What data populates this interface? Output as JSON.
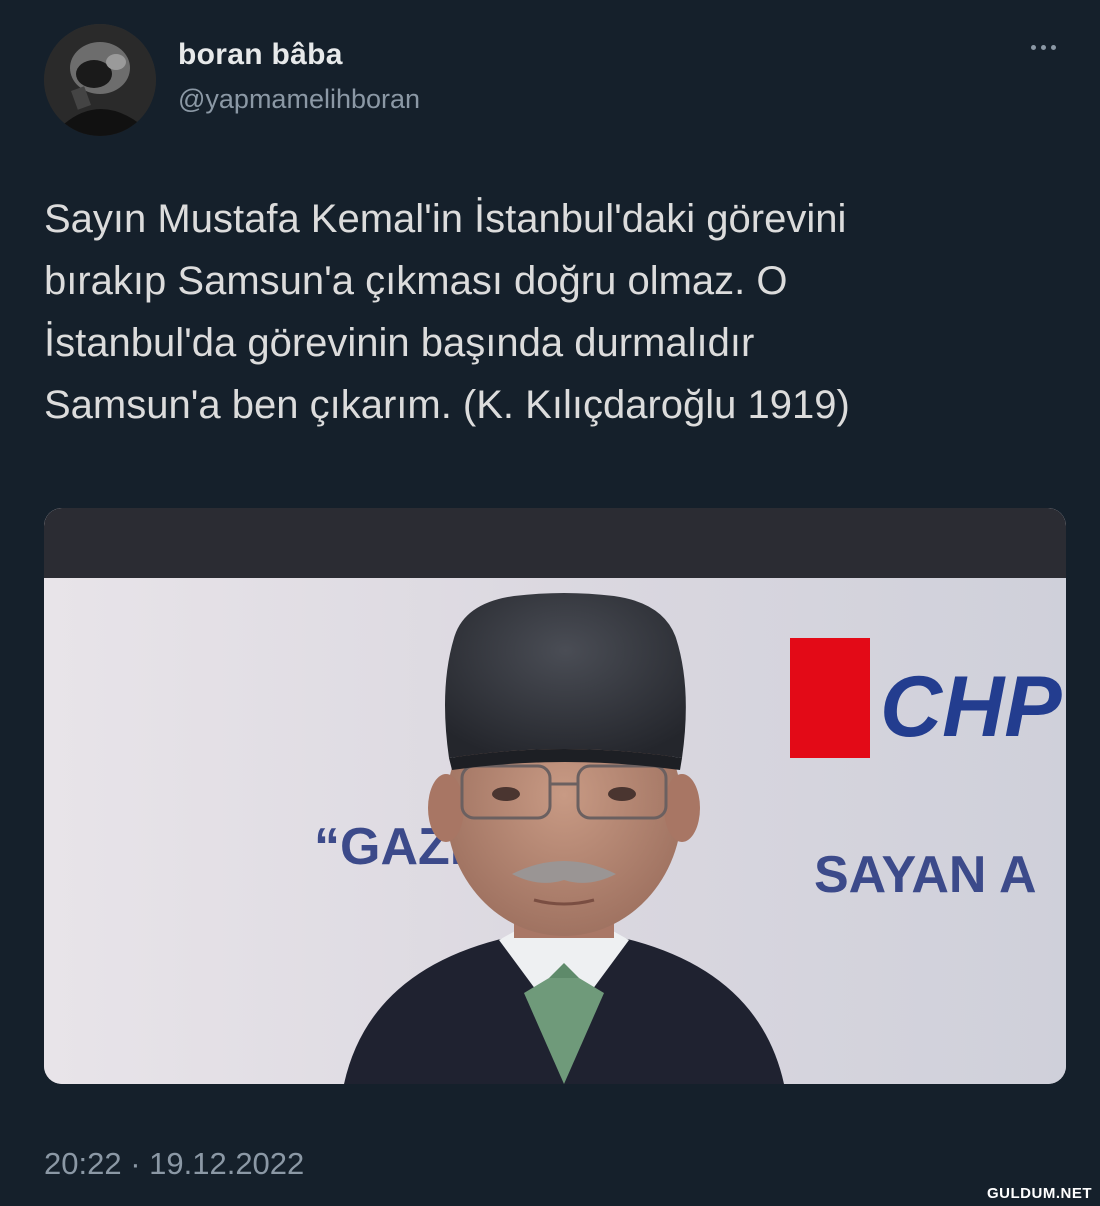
{
  "tweet": {
    "author": {
      "display_name": "boran bâba",
      "handle": "@yapmamelihboran",
      "avatar_icon": "avatar-photo"
    },
    "more_icon": "more-horizontal-icon",
    "text_lines": [
      "Sayın Mustafa Kemal'in İstanbul'daki görevini",
      "bırakıp Samsun'a çıkması doğru olmaz. O",
      "İstanbul'da görevinin başında durmalıdır",
      "Samsun'a ben çıkarım. (K. Kılıçdaroğlu 1919)"
    ],
    "media": {
      "banner_logo_text": "CHP",
      "banner_slogan_left": "“GAZİ",
      "banner_slogan_right": "SAYAN A"
    },
    "timestamp": "20:22 · 19.12.2022"
  },
  "watermark": "GULDUM.NET",
  "colors": {
    "background": "#15202b",
    "text": "#dcdcdc",
    "secondary_text": "#8b98a5",
    "chp_red": "#e30a17",
    "chp_navy": "#233d8f"
  }
}
